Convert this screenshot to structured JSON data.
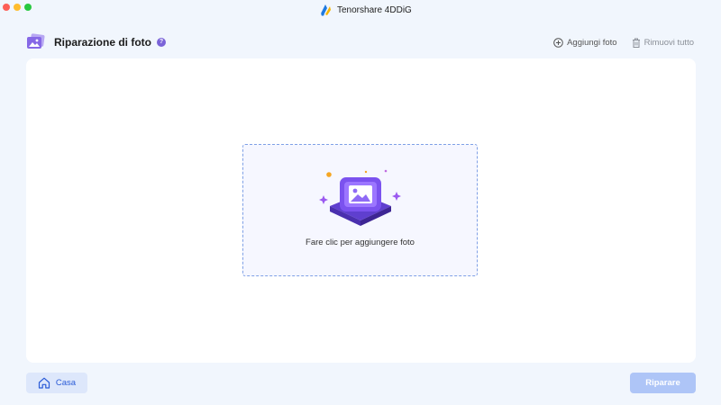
{
  "window": {
    "app_title": "Tenorshare 4DDiG",
    "app_logo_icon": "4ddig-logo-icon",
    "controls": [
      "close",
      "minimize",
      "zoom"
    ]
  },
  "header": {
    "title": "Riparazione di foto",
    "title_icon": "photo-stack-icon",
    "help_symbol": "?",
    "add_photo_label": "Aggiungi foto",
    "remove_all_label": "Rimuovi tutto"
  },
  "dropzone": {
    "icon": "image-upload-icon",
    "text": "Fare clic per aggiungere foto"
  },
  "footer": {
    "home_label": "Casa",
    "repair_label": "Riparare"
  },
  "colors": {
    "background": "#f1f6fd",
    "accent": "#2a5bd7",
    "dropzone_border": "#7fa0e6",
    "repair_disabled": "#aec5f7",
    "purple": "#7a63d8"
  }
}
